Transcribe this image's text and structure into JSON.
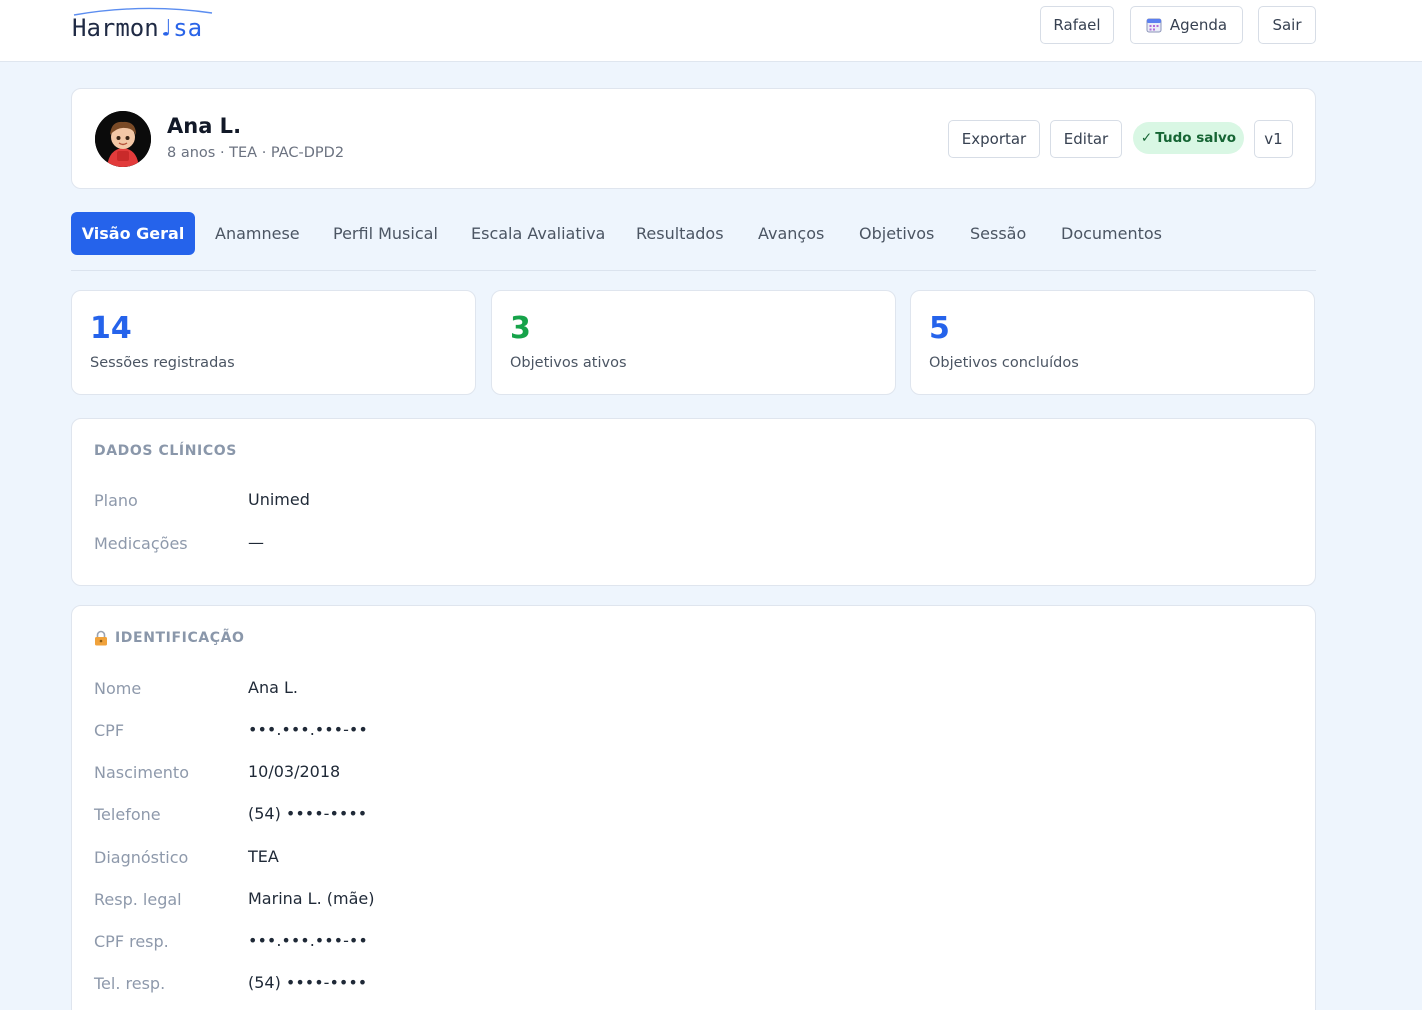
{
  "app": {
    "logo_left": "Harmon",
    "logo_right": "sa",
    "logo_note": "♩"
  },
  "topbar": {
    "user_label": "Rafael",
    "agenda_label": "Agenda",
    "logout_label": "Sair"
  },
  "patient": {
    "name": "Ana L.",
    "meta": "8 anos · TEA · PAC-DPD2",
    "export_label": "Exportar",
    "edit_label": "Editar",
    "saved_label": "Tudo salvo",
    "saved_check": "✓",
    "version_label": "v1"
  },
  "tabs": [
    {
      "label": "Visão Geral",
      "active": true
    },
    {
      "label": "Anamnese"
    },
    {
      "label": "Perfil Musical"
    },
    {
      "label": "Escala Avaliativa"
    },
    {
      "label": "Resultados"
    },
    {
      "label": "Avanços"
    },
    {
      "label": "Objetivos"
    },
    {
      "label": "Sessão"
    },
    {
      "label": "Documentos"
    }
  ],
  "stats": [
    {
      "value": "14",
      "label": "Sessões registradas",
      "color": "#2563eb"
    },
    {
      "value": "3",
      "label": "Objetivos ativos",
      "color": "#16a34a"
    },
    {
      "value": "5",
      "label": "Objetivos concluídos",
      "color": "#2563eb"
    }
  ],
  "clinical": {
    "title": "DADOS CLÍNICOS",
    "rows": [
      {
        "label": "Plano",
        "value": "Unimed"
      },
      {
        "label": "Medicações",
        "value": "—"
      }
    ]
  },
  "identification": {
    "title": "IDENTIFICAÇÃO",
    "rows": [
      {
        "label": "Nome",
        "value": "Ana L."
      },
      {
        "label": "CPF",
        "value": "•••.•••.•••-••"
      },
      {
        "label": "Nascimento",
        "value": "10/03/2018"
      },
      {
        "label": "Telefone",
        "value": "(54) ••••-••••"
      },
      {
        "label": "Diagnóstico",
        "value": "TEA"
      },
      {
        "label": "Resp. legal",
        "value": "Marina L. (mãe)"
      },
      {
        "label": "CPF resp.",
        "value": "•••.•••.•••-••"
      },
      {
        "label": "Tel. resp.",
        "value": "(54) ••••-••••"
      }
    ]
  },
  "colors": {
    "accent": "#2563eb",
    "success": "#16a34a",
    "background": "#eef5fd"
  }
}
